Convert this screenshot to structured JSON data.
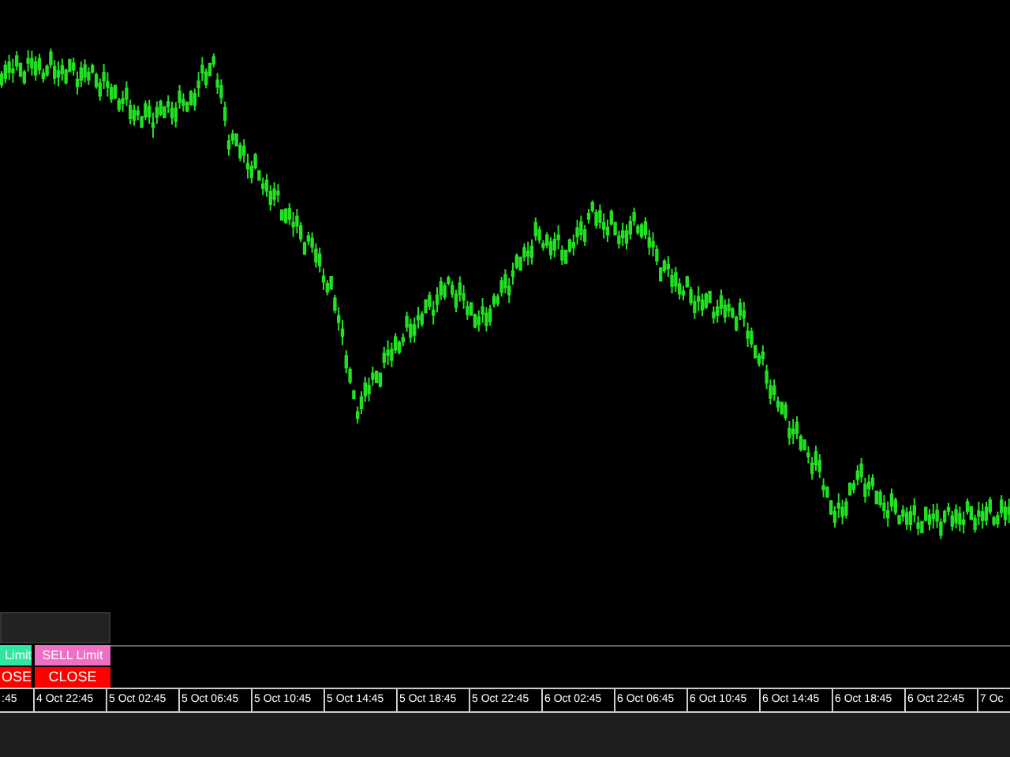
{
  "order_panel": {
    "order_buttons": [
      {
        "label": "Limit",
        "kind": "buy_limit"
      },
      {
        "label": "SELL Limit",
        "kind": "sell_limit"
      }
    ],
    "close_buttons": [
      "OSE",
      "CLOSE"
    ]
  },
  "time_axis": {
    "labels": [
      ":45",
      "4 Oct 22:45",
      "5 Oct 02:45",
      "5 Oct 06:45",
      "5 Oct 10:45",
      "5 Oct 14:45",
      "5 Oct 18:45",
      "5 Oct 22:45",
      "6 Oct 02:45",
      "6 Oct 06:45",
      "6 Oct 10:45",
      "6 Oct 14:45",
      "6 Oct 18:45",
      "6 Oct 22:45",
      "7 Oc"
    ]
  }
}
